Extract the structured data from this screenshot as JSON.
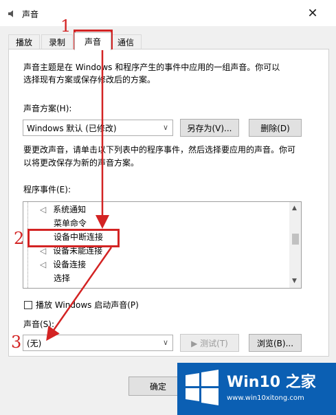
{
  "window": {
    "title": "声音",
    "close": "✕"
  },
  "tabs": [
    {
      "label": "播放"
    },
    {
      "label": "录制"
    },
    {
      "label": "声音"
    },
    {
      "label": "通信"
    }
  ],
  "description": {
    "line1": "声音主题是在 Windows 和程序产生的事件中应用的一组声音。你可以",
    "line2": "选择现有方案或保存修改后的方案。"
  },
  "scheme": {
    "label": "声音方案(H):",
    "selected": "Windows 默认 (已修改)",
    "save_as": "另存为(V)...",
    "delete": "删除(D)"
  },
  "change_hint": {
    "line1": "要更改声音，请单击以下列表中的程序事件，然后选择要应用的声音。你可",
    "line2": "以将更改保存为新的声音方案。"
  },
  "events": {
    "label": "程序事件(E):",
    "items": [
      {
        "label": "系统通知"
      },
      {
        "label": "菜单命令"
      },
      {
        "label": "设备中断连接"
      },
      {
        "label": "设备未能连接"
      },
      {
        "label": "设备连接"
      },
      {
        "label": "选择"
      }
    ]
  },
  "startup": {
    "label": "播放 Windows 启动声音(P)"
  },
  "sound": {
    "label": "声音(S):",
    "selected": "(无)",
    "test": "▶ 测试(T)",
    "browse": "浏览(B)..."
  },
  "footer": {
    "ok": "确定"
  },
  "annotations": {
    "n1": "1",
    "n2": "2",
    "n3": "3"
  },
  "watermark": {
    "brand": "Win10 之家",
    "url": "www.win10xitong.com"
  },
  "colors": {
    "accent_red": "#d32323",
    "brand_blue": "#0b5fb3"
  }
}
